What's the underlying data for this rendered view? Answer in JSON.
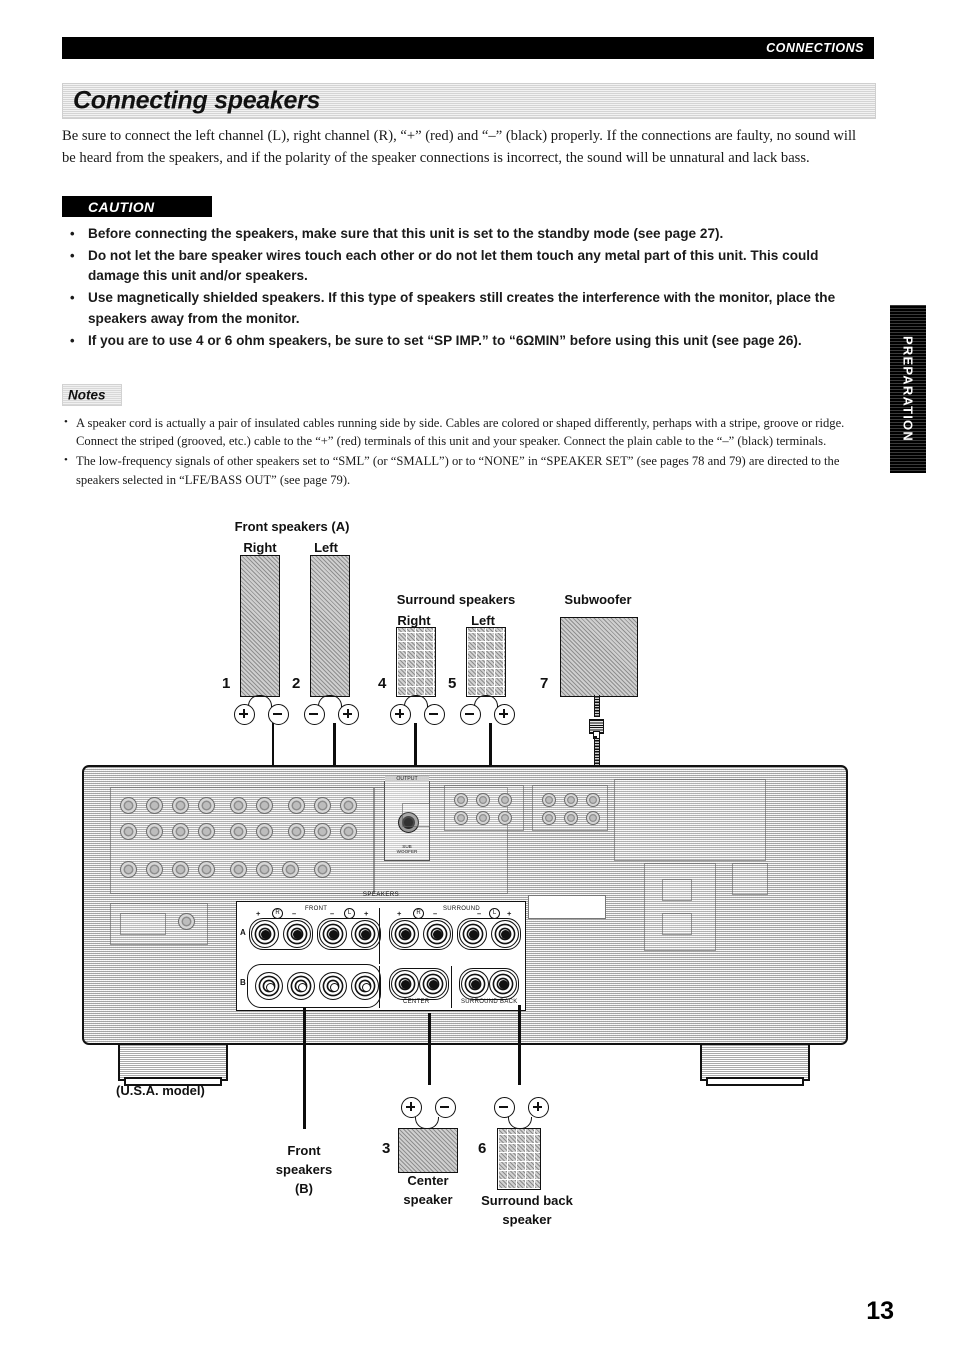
{
  "running_head": {
    "label": "CONNECTIONS"
  },
  "section": {
    "title": "Connecting speakers"
  },
  "intro": {
    "paragraph": "Be sure to connect the left channel (L), right channel (R), “+” (red) and “–” (black) properly. If the connections are faulty, no sound will be heard from the speakers, and if the polarity of the speaker connections is incorrect, the sound will be unnatural and lack bass."
  },
  "caution": {
    "tag": "CAUTION",
    "bullet": "•",
    "items": [
      "Before connecting the speakers, make sure that this unit is set to the standby mode (see page 27).",
      "Do not let the bare speaker wires touch each other or do not let them touch any metal part of this unit. This could damage this unit and/or speakers.",
      "Use magnetically shielded speakers. If this type of speakers still creates the interference with the monitor, place the speakers away from the monitor.",
      "If you are to use 4 or 6 ohm speakers, be sure to set “SP IMP.” to “6ΩMIN” before using this unit (see page 26)."
    ]
  },
  "notes": {
    "tag": "Notes",
    "bullet": "•",
    "items": [
      "A speaker cord is actually a pair of insulated cables running side by side. Cables are colored or shaped differently, perhaps with a stripe, groove or ridge. Connect the striped (grooved, etc.) cable to the “+” (red) terminals of this unit and your speaker. Connect the plain cable to the “–” (black) terminals.",
      "The low-frequency signals of other speakers set to “SML” (or “SMALL”) or to “NONE” in “SPEAKER SET” (see pages 78 and 79) are directed to the speakers selected in “LFE/BASS OUT” (see page 79)."
    ]
  },
  "side_tab": {
    "label": "PREPARATION"
  },
  "page_number": "13",
  "diagram": {
    "front_speakers_title": "Front speakers (A)",
    "front_right": "Right",
    "front_left": "Left",
    "surround_title": "Surround speakers",
    "surround_right": "Right",
    "surround_left": "Left",
    "subwoofer": "Subwoofer",
    "front_b_line1": "Front",
    "front_b_line2": "speakers",
    "front_b_line3": "(B)",
    "center_line1": "Center",
    "center_line2": "speaker",
    "surround_back_line1": "Surround back",
    "surround_back_line2": "speaker",
    "model_note": "(U.S.A. model)",
    "numbers": {
      "front_right": "1",
      "front_left": "2",
      "center": "3",
      "surround_right": "4",
      "surround_left": "5",
      "surround_back": "6",
      "subwoofer": "7"
    },
    "panel": {
      "speakers_caption": "SPEAKERS",
      "row_a": "A",
      "row_b": "B",
      "group_front": "FRONT",
      "group_surround": "SURROUND",
      "group_center": "CENTER",
      "group_surround_back": "SURROUND BACK",
      "plus": "+",
      "minus": "–",
      "right_mark": "R",
      "left_mark": "L",
      "output_caption": "OUTPUT",
      "output_jack_line1": "SUB",
      "output_jack_line2": "WOOFER"
    }
  }
}
